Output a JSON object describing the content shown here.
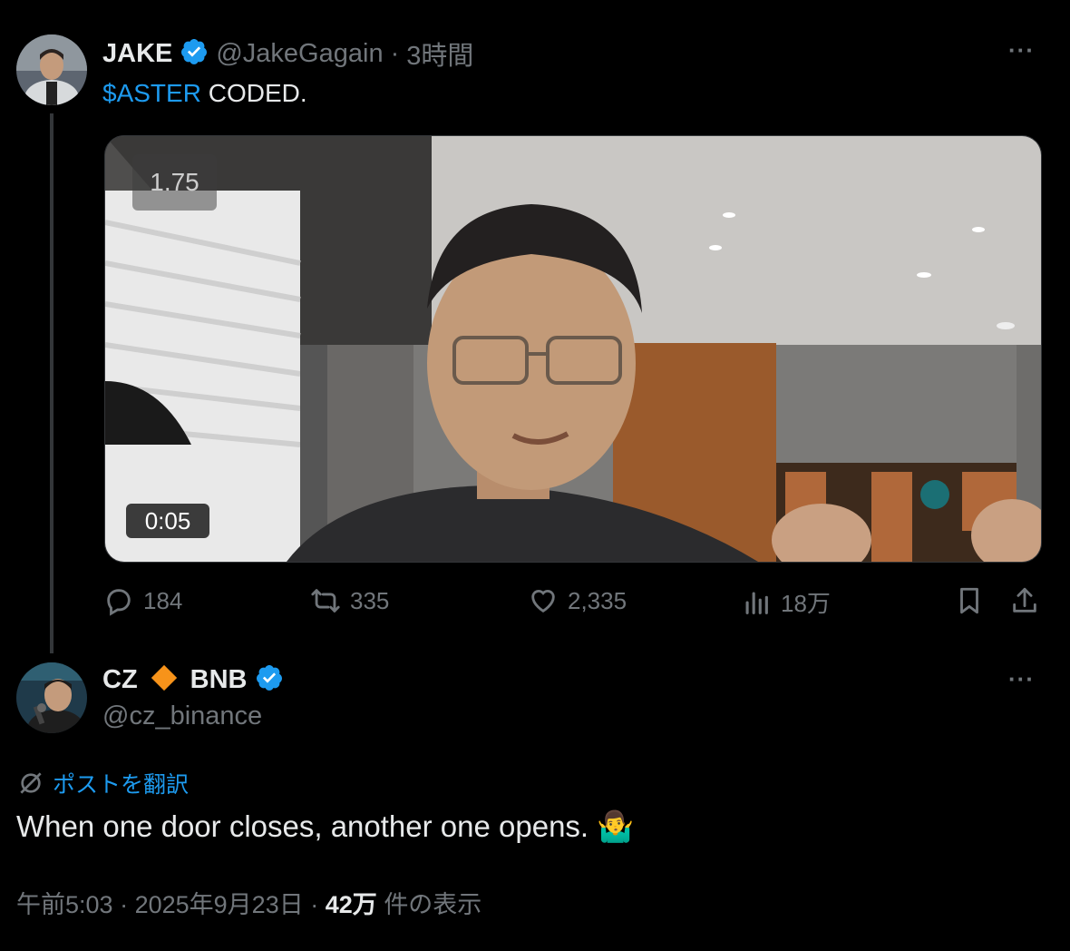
{
  "post1": {
    "display_name": "JAKE",
    "handle": "@JakeGagain",
    "separator": "·",
    "time": "3時間",
    "more": "···",
    "cashtag": "$ASTER",
    "text": " CODED.",
    "video": {
      "speed": "1.75",
      "duration": "0:05"
    },
    "actions": {
      "replies": "184",
      "reposts": "335",
      "likes": "2,335",
      "views": "18万"
    }
  },
  "post2": {
    "display_name_part1": "CZ",
    "display_name_part2": "BNB",
    "handle": "@cz_binance",
    "more": "···",
    "translate_label": "ポストを翻訳",
    "text": "When one door closes, another one opens. 🤷‍♂️",
    "meta": {
      "time": "午前5:03",
      "sep1": "·",
      "date": "2025年9月23日",
      "sep2": "·",
      "views_count": "42万",
      "views_label": "件の表示"
    }
  },
  "colors": {
    "accent": "#1d9bf0",
    "muted": "#71767b",
    "text": "#e7e9ea",
    "diamond": "#f7931a"
  }
}
